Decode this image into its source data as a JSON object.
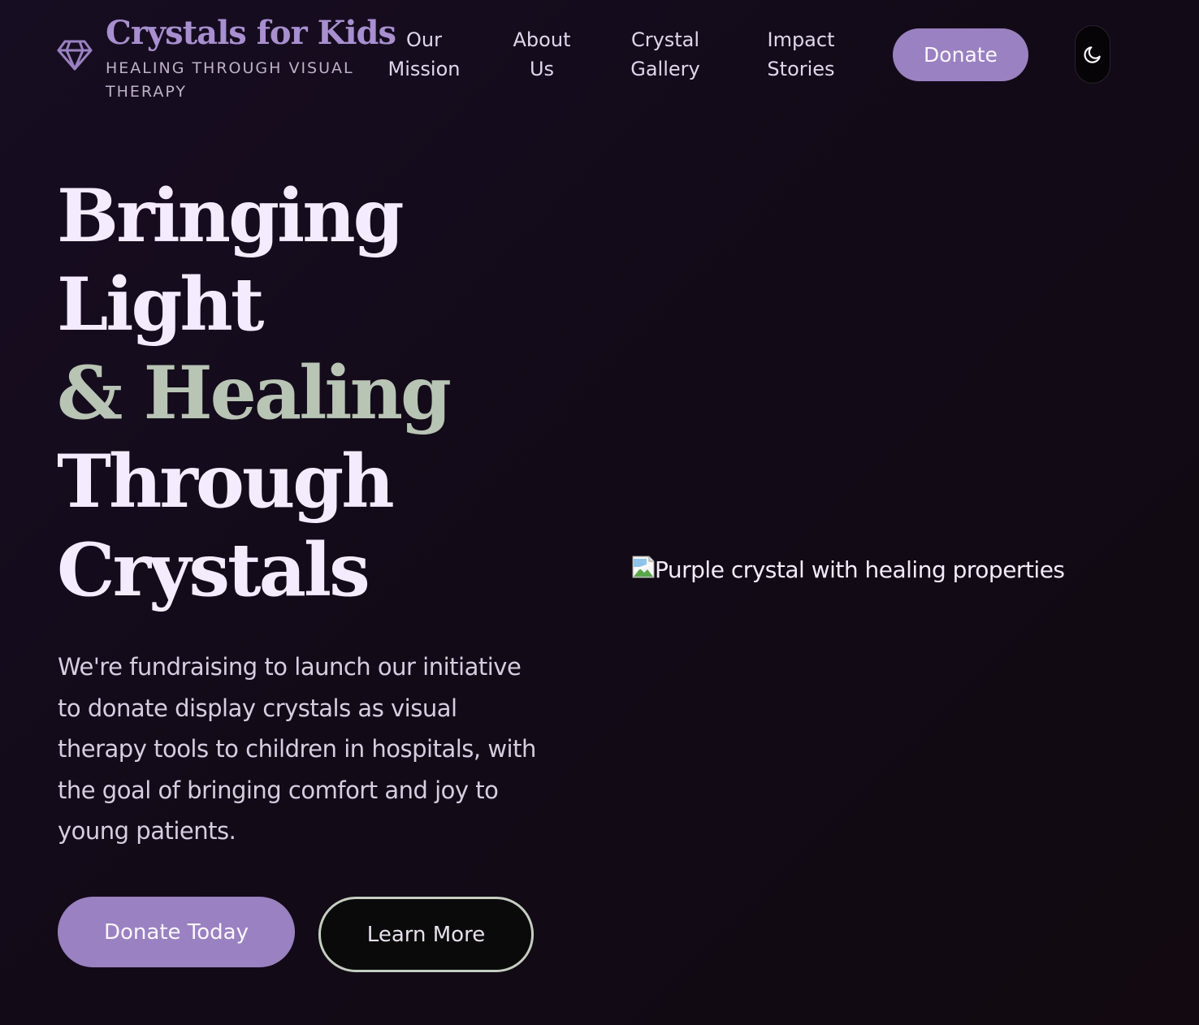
{
  "brand": {
    "name": "Crystals for Kids",
    "tagline": "HEALING THROUGH VISUAL THERAPY",
    "icon": "gem-icon"
  },
  "nav": {
    "links": [
      "Our Mission",
      "About Us",
      "Crystal Gallery",
      "Impact Stories"
    ],
    "donate_label": "Donate",
    "theme_toggle_icon": "moon-icon"
  },
  "hero": {
    "title_lines": [
      "Bringing",
      "Light",
      "& Healing",
      "Through",
      "Crystals"
    ],
    "description": "We're fundraising to launch our initiative to donate display crystals as visual therapy tools to children in hospitals, with the goal of bringing comfort and joy to young patients.",
    "primary_cta": "Donate Today",
    "secondary_cta": "Learn More",
    "image_alt": "Purple crystal with healing properties"
  },
  "colors": {
    "accent": "#9a81c1",
    "brand_title": "#a88fd0",
    "sage": "#b8c4b4",
    "background": "#150c1c"
  }
}
